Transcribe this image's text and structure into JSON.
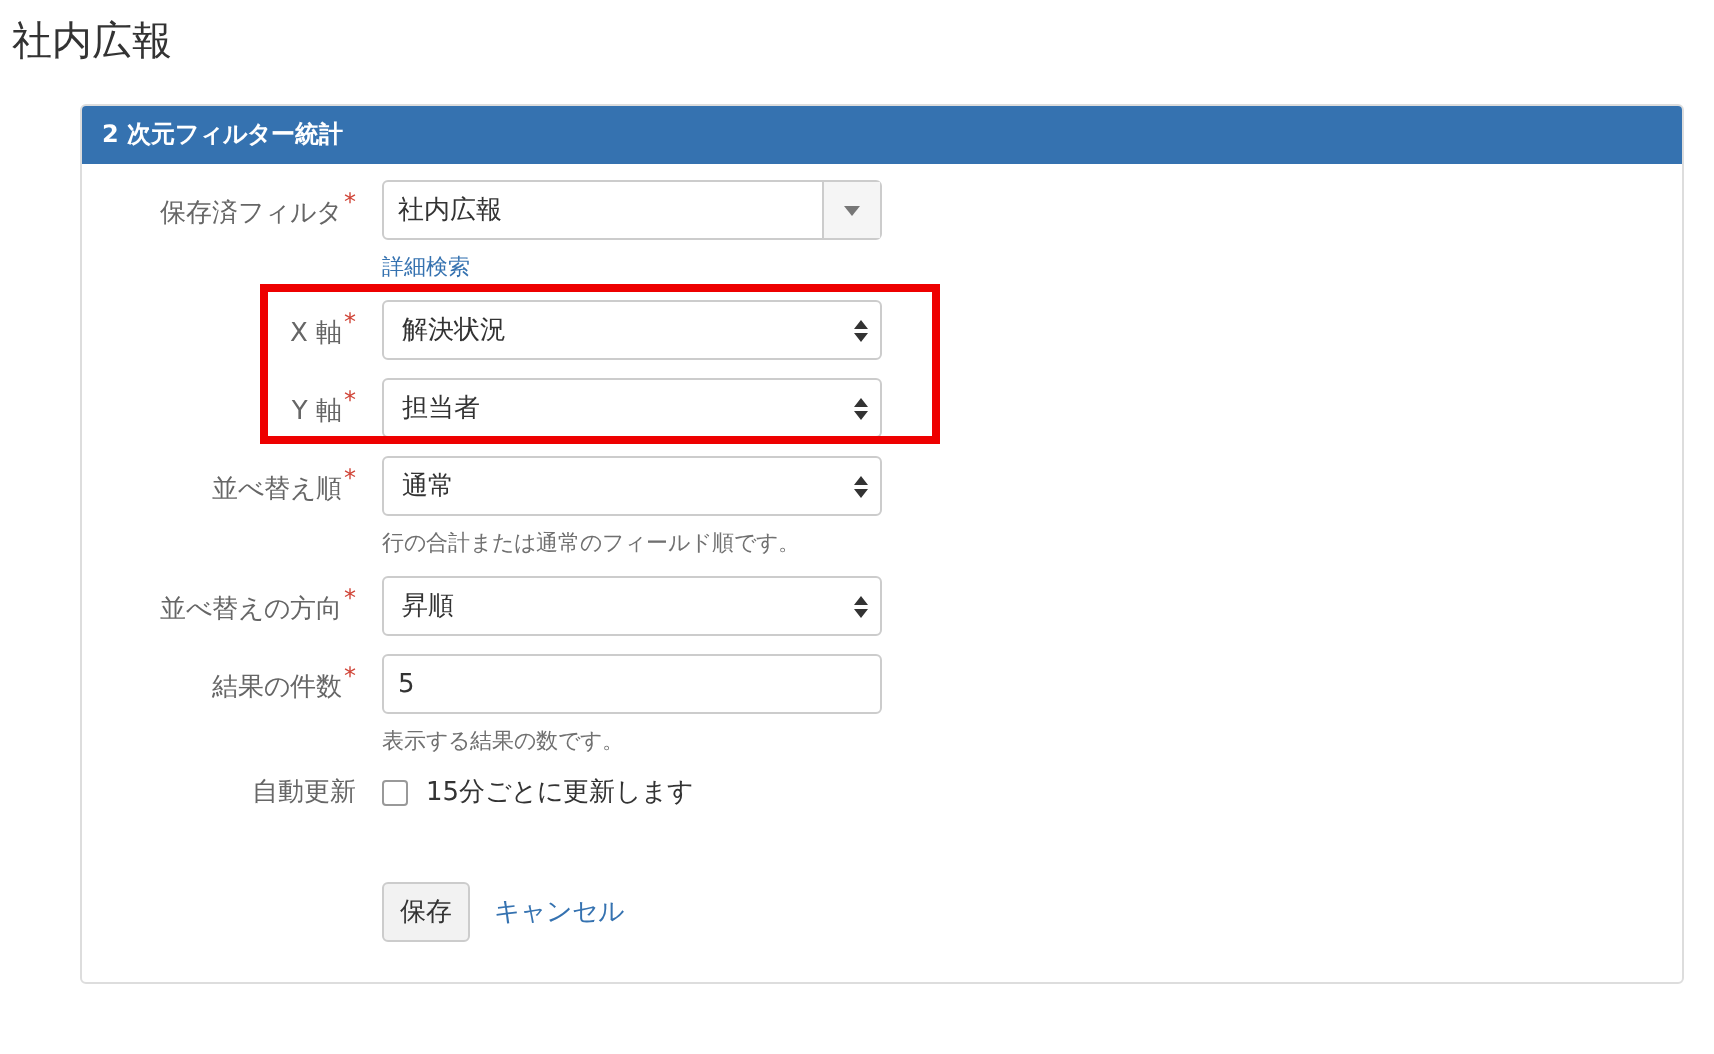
{
  "page_title": "社内広報",
  "panel": {
    "title": "2 次元フィルター統計"
  },
  "fields": [
    {
      "kind": "combo",
      "label": "保存済フィルタ",
      "required_mark": "*",
      "value": "社内広報",
      "link": "詳細検索",
      "highlighted": false
    },
    {
      "kind": "select",
      "label": "X 軸",
      "required_mark": "*",
      "value": "解決状況",
      "highlighted": true
    },
    {
      "kind": "select",
      "label": "Y 軸",
      "required_mark": "*",
      "value": "担当者",
      "highlighted": true
    },
    {
      "kind": "select",
      "label": "並べ替え順",
      "required_mark": "*",
      "value": "通常",
      "help": "行の合計または通常のフィールド順です。",
      "highlighted": false
    },
    {
      "kind": "select",
      "label": "並べ替えの方向",
      "required_mark": "*",
      "value": "昇順",
      "highlighted": false
    },
    {
      "kind": "text",
      "label": "結果の件数",
      "required_mark": "*",
      "value": "5",
      "help": "表示する結果の数です。",
      "highlighted": false
    },
    {
      "kind": "checkbox",
      "label": "自動更新",
      "option": "15分ごとに更新します",
      "checked": false,
      "highlighted": false
    }
  ],
  "buttons": {
    "save": "保存",
    "cancel": "キャンセル"
  }
}
